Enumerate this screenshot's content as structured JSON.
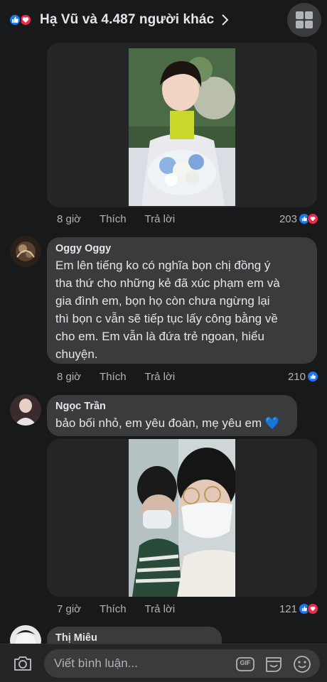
{
  "header": {
    "title": "Hạ Vũ và 4.487 người khác"
  },
  "comments": [
    {
      "actions": {
        "time": "8 giờ",
        "like": "Thích",
        "reply": "Trả lời"
      },
      "reaction_count": "203"
    },
    {
      "author": "Oggy Oggy",
      "text_lines": [
        "Em lên tiếng ko có nghĩa bọn chị đồng ý",
        "tha thứ cho những kẻ đã xúc phạm em và",
        "gia đình em, bọn họ còn chưa ngừng lại",
        "thì bọn c vẫn sẽ tiếp tục lấy công bằng về",
        "cho em. Em vẫn là đứa trẻ ngoan, hiểu",
        "chuyện."
      ],
      "actions": {
        "time": "8 giờ",
        "like": "Thích",
        "reply": "Trả lời"
      },
      "reaction_count": "210"
    },
    {
      "author": "Ngọc Trần",
      "text": "bảo bối nhỏ, em yêu đoàn, mẹ yêu em",
      "emoji": "💙",
      "actions": {
        "time": "7 giờ",
        "like": "Thích",
        "reply": "Trả lời"
      },
      "reaction_count": "121"
    },
    {
      "author": "Thị Miêu"
    }
  ],
  "composer": {
    "placeholder": "Viết bình luận...",
    "gif_label": "GIF"
  },
  "colors": {
    "background": "#18191a",
    "bubble": "#3a3b3c",
    "like_blue": "#1877f2",
    "love_red": "#f02849"
  }
}
